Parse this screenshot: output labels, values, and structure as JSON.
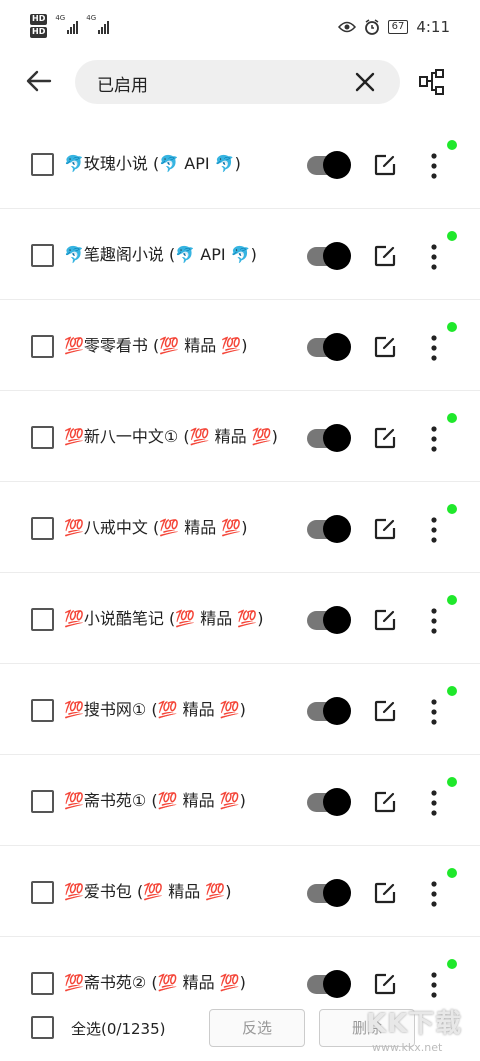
{
  "status_bar": {
    "hd1": "HD",
    "hd2": "HD",
    "net1": "4G",
    "net2": "4G",
    "battery": "67",
    "time": "4:11"
  },
  "top_bar": {
    "back_icon": "arrow-left-icon",
    "search_value": "已启用",
    "clear_icon": "close-icon",
    "group_icon": "tree-structure-icon"
  },
  "sources": [
    {
      "name": "🐬玫瑰小说 (🐬 API 🐬)",
      "enabled": true
    },
    {
      "name": "🐬笔趣阁小说 (🐬 API 🐬)",
      "enabled": true
    },
    {
      "name": "💯零零看书 (💯 精品 💯)",
      "enabled": true
    },
    {
      "name": "💯新八一中文① (💯 精品 💯)",
      "enabled": true
    },
    {
      "name": "💯八戒中文 (💯 精品 💯)",
      "enabled": true
    },
    {
      "name": "💯小说酷笔记 (💯 精品 💯)",
      "enabled": true
    },
    {
      "name": "💯搜书网① (💯 精品 💯)",
      "enabled": true
    },
    {
      "name": "💯斋书苑① (💯 精品 💯)",
      "enabled": true
    },
    {
      "name": "💯爱书包 (💯 精品 💯)",
      "enabled": true
    },
    {
      "name": "💯斋书苑② (💯 精品 💯)",
      "enabled": true
    }
  ],
  "row_icons": {
    "edit": "edit-icon",
    "more": "more-vertical-icon",
    "status": "status-dot"
  },
  "colors": {
    "status_dot": "#1fe82b",
    "toggle_knob": "#000000",
    "toggle_track": "#777777"
  },
  "bottom_bar": {
    "select_all": "全选(0/1235)",
    "invert": "反选",
    "delete": "删除"
  },
  "watermark": {
    "logo": "KK下载",
    "url": "www.kkx.net"
  }
}
